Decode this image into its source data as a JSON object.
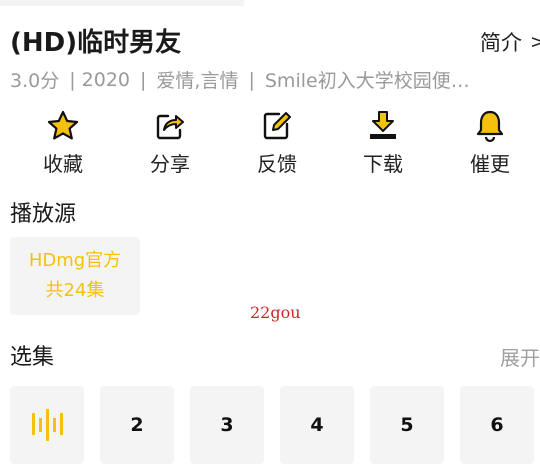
{
  "header": {
    "title": "(HD)临时男友",
    "intro_label": "简介",
    "intro_chevron": ">"
  },
  "meta": {
    "score": "3.0分",
    "year": "| 2020",
    "genres": "爱情,言情",
    "synopsis": "Smile初入大学校园便…",
    "separator": "|"
  },
  "actions": [
    {
      "label": "收藏",
      "icon": "star-icon"
    },
    {
      "label": "分享",
      "icon": "share-icon"
    },
    {
      "label": "反馈",
      "icon": "feedback-icon"
    },
    {
      "label": "下载",
      "icon": "download-icon"
    },
    {
      "label": "催更",
      "icon": "bell-icon"
    }
  ],
  "sources": {
    "title": "播放源",
    "items": [
      {
        "name": "HDmg官方",
        "count": "共24集"
      }
    ]
  },
  "watermark": "22gou",
  "episodes": {
    "title": "选集",
    "expand_label": "展开",
    "items": [
      {
        "label": "",
        "icon": "playing-bars-icon",
        "current": true
      },
      {
        "label": "2"
      },
      {
        "label": "3"
      },
      {
        "label": "4"
      },
      {
        "label": "5"
      },
      {
        "label": "6"
      }
    ]
  },
  "colors": {
    "accent": "#f5c10e",
    "text_primary": "#1a1a1a",
    "text_secondary": "#9a9a9a",
    "card_bg": "#f4f4f4"
  }
}
